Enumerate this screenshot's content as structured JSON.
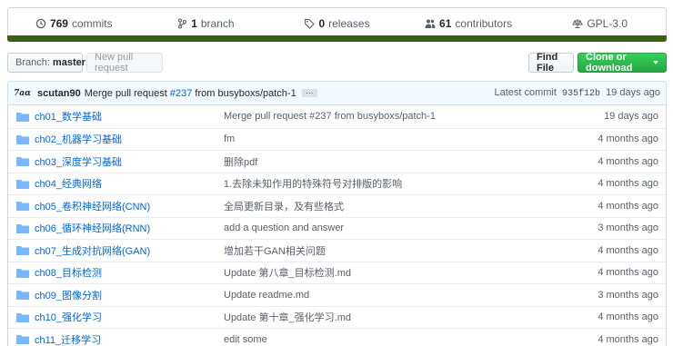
{
  "stats": {
    "commits_count": "769",
    "commits_label": "commits",
    "branch_count": "1",
    "branch_label": "branch",
    "releases_count": "0",
    "releases_label": "releases",
    "contributors_count": "61",
    "contributors_label": "contributors",
    "license": "GPL-3.0"
  },
  "language_bar_color": "#3b5f14",
  "toolbar": {
    "branch_label": "Branch:",
    "branch_value": "master",
    "new_pr": "New pull request",
    "find_file": "Find File",
    "clone": "Clone or download"
  },
  "latest_commit": {
    "avatar_text": "7aα",
    "author": "scutan90",
    "message_prefix": "Merge pull request",
    "pr_ref": "#237",
    "message_suffix": "from busyboxs/patch-1",
    "ellipsis": "…",
    "latest_label": "Latest commit",
    "sha": "935f12b",
    "age": "19 days ago"
  },
  "files": [
    {
      "name": "ch01_数学基础",
      "message": "Merge pull request #237 from busyboxs/patch-1",
      "age": "19 days ago"
    },
    {
      "name": "ch02_机器学习基础",
      "message": "fm",
      "age": "4 months ago"
    },
    {
      "name": "ch03_深度学习基础",
      "message": "删除pdf",
      "age": "4 months ago"
    },
    {
      "name": "ch04_经典网络",
      "message": "1.去除未知作用的特殊符号对排版的影响",
      "age": "4 months ago"
    },
    {
      "name": "ch05_卷积神经网络(CNN)",
      "message": "全局更新目录，及有些格式",
      "age": "4 months ago"
    },
    {
      "name": "ch06_循环神经网络(RNN)",
      "message": "add a question and answer",
      "age": "3 months ago"
    },
    {
      "name": "ch07_生成对抗网络(GAN)",
      "message": "增加若干GAN相关问题",
      "age": "4 months ago"
    },
    {
      "name": "ch08_目标检测",
      "message": "Update 第八章_目标检测.md",
      "age": "4 months ago"
    },
    {
      "name": "ch09_图像分割",
      "message": "Update readme.md",
      "age": "3 months ago"
    },
    {
      "name": "ch10_强化学习",
      "message": "Update 第十章_强化学习.md",
      "age": "4 months ago"
    },
    {
      "name": "ch11_迁移学习",
      "message": "edit some",
      "age": "4 months ago"
    }
  ]
}
